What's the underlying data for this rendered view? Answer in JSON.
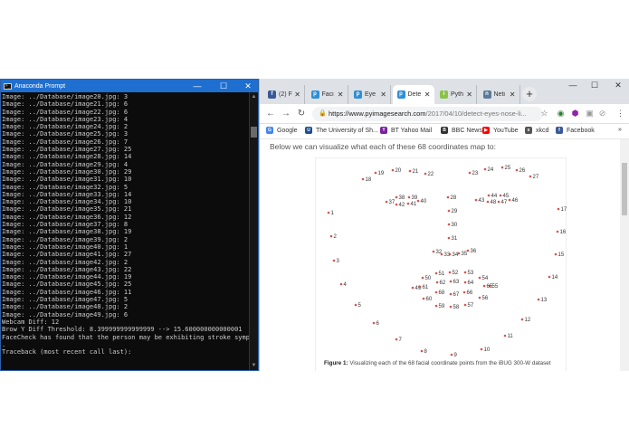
{
  "prompt": {
    "title": "Anaconda Prompt",
    "lines": [
      "Image: ../Database/image20.jpg: 3",
      "Image: ../Database/image21.jpg: 6",
      "Image: ../Database/image22.jpg: 6",
      "Image: ../Database/image23.jpg: 4",
      "Image: ../Database/image24.jpg: 2",
      "Image: ../Database/image25.jpg: 3",
      "Image: ../Database/image26.jpg: 7",
      "Image: ../Database/image27.jpg: 25",
      "Image: ../Database/image28.jpg: 14",
      "Image: ../Database/image29.jpg: 4",
      "Image: ../Database/image30.jpg: 29",
      "Image: ../Database/image31.jpg: 10",
      "Image: ../Database/image32.jpg: 5",
      "Image: ../Database/image33.jpg: 14",
      "Image: ../Database/image34.jpg: 10",
      "Image: ../Database/image35.jpg: 21",
      "Image: ../Database/image36.jpg: 12",
      "Image: ../Database/image37.jpg: 8",
      "Image: ../Database/image38.jpg: 19",
      "Image: ../Database/image39.jpg: 2",
      "Image: ../Database/image40.jpg: 1",
      "Image: ../Database/image41.jpg: 27",
      "Image: ../Database/image42.jpg: 2",
      "Image: ../Database/image43.jpg: 22",
      "Image: ../Database/image44.jpg: 19",
      "Image: ../Database/image45.jpg: 25",
      "Image: ../Database/image46.jpg: 11",
      "Image: ../Database/image47.jpg: 5",
      "Image: ../Database/image48.jpg: 2",
      "Image: ../Database/image49.jpg: 6",
      "Webcam Diff: 12",
      "Brow Y Diff Threshold: 8.399999999999999 --> 15.600000000000001",
      "FaceCheck has found that the person may be exhibiting stroke symptoms",
      ".",
      "Traceback (most recent call last):"
    ]
  },
  "browser": {
    "tabs": [
      {
        "label": "(2) F",
        "favicon": "f",
        "color": "#3b5998"
      },
      {
        "label": "Faci",
        "favicon": "p",
        "color": "#2d8fd5"
      },
      {
        "label": "Eye",
        "favicon": "p",
        "color": "#2d8fd5"
      },
      {
        "label": "Dete",
        "favicon": "p",
        "color": "#2d8fd5"
      },
      {
        "label": "Pyth",
        "favicon": "ipy",
        "color": "#8bc34a"
      },
      {
        "label": "Neti",
        "favicon": "n",
        "color": "#5b7a99"
      }
    ],
    "active_tab": 3,
    "url_domain": "https://www.pyimagesearch.com",
    "url_path": "/2017/04/10/detect-eyes-nose-li...",
    "bookmarks": [
      {
        "label": "Google",
        "icon": "G",
        "color": "#4285f4"
      },
      {
        "label": "The University of Sh...",
        "icon": "U",
        "color": "#1d4f91"
      },
      {
        "label": "BT Yahoo Mail",
        "icon": "Y",
        "color": "#7b1fa2"
      },
      {
        "label": "BBC News",
        "icon": "BBC",
        "color": "#333333"
      },
      {
        "label": "YouTube",
        "icon": "▶",
        "color": "#ff0000"
      },
      {
        "label": "xkcd",
        "icon": "x",
        "color": "#555555"
      },
      {
        "label": "Facebook",
        "icon": "f",
        "color": "#3b5998"
      }
    ],
    "bookmarks_more": "»"
  },
  "article": {
    "intro": "Below we can visualize what each of these 68 coordinates map to:",
    "caption_label": "Figure 1:",
    "caption_text": "Visualizing each of the 68 facial coordinate points from the iBUG 300-W dataset"
  },
  "landmarks": [
    [
      1,
      14,
      60
    ],
    [
      2,
      17,
      86
    ],
    [
      3,
      20,
      113
    ],
    [
      4,
      28,
      139
    ],
    [
      5,
      44,
      162
    ],
    [
      6,
      64,
      182
    ],
    [
      7,
      89,
      200
    ],
    [
      8,
      117,
      213
    ],
    [
      9,
      150,
      217
    ],
    [
      10,
      183,
      211
    ],
    [
      11,
      209,
      196
    ],
    [
      12,
      228,
      178
    ],
    [
      13,
      246,
      156
    ],
    [
      14,
      258,
      131
    ],
    [
      15,
      265,
      106
    ],
    [
      16,
      267,
      81
    ],
    [
      17,
      268,
      56
    ],
    [
      18,
      52,
      23
    ],
    [
      19,
      66,
      16
    ],
    [
      20,
      85,
      13
    ],
    [
      21,
      104,
      14
    ],
    [
      22,
      121,
      17
    ],
    [
      23,
      170,
      16
    ],
    [
      24,
      187,
      12
    ],
    [
      25,
      206,
      10
    ],
    [
      26,
      222,
      13
    ],
    [
      27,
      237,
      20
    ],
    [
      28,
      146,
      43
    ],
    [
      29,
      147,
      58
    ],
    [
      30,
      147,
      73
    ],
    [
      31,
      147,
      88
    ],
    [
      32,
      130,
      103
    ],
    [
      33,
      139,
      106
    ],
    [
      34,
      148,
      106
    ],
    [
      35,
      158,
      105
    ],
    [
      36,
      168,
      102
    ],
    [
      37,
      78,
      48
    ],
    [
      38,
      89,
      43
    ],
    [
      39,
      103,
      43
    ],
    [
      40,
      113,
      47
    ],
    [
      41,
      102,
      50
    ],
    [
      42,
      89,
      51
    ],
    [
      43,
      177,
      46
    ],
    [
      44,
      191,
      41
    ],
    [
      45,
      204,
      41
    ],
    [
      46,
      214,
      46
    ],
    [
      47,
      202,
      48
    ],
    [
      48,
      190,
      48
    ],
    [
      49,
      107,
      143
    ],
    [
      50,
      118,
      132
    ],
    [
      51,
      133,
      127
    ],
    [
      52,
      148,
      126
    ],
    [
      53,
      165,
      126
    ],
    [
      54,
      181,
      132
    ],
    [
      55,
      192,
      141
    ],
    [
      56,
      181,
      154
    ],
    [
      57,
      165,
      162
    ],
    [
      58,
      149,
      164
    ],
    [
      59,
      133,
      163
    ],
    [
      60,
      119,
      155
    ],
    [
      61,
      115,
      142
    ],
    [
      62,
      134,
      137
    ],
    [
      63,
      149,
      136
    ],
    [
      64,
      165,
      137
    ],
    [
      65,
      186,
      141
    ],
    [
      66,
      164,
      148
    ],
    [
      67,
      149,
      150
    ],
    [
      68,
      133,
      148
    ]
  ],
  "colors": {
    "titlebar": "#1f6fd1",
    "landmark_point": "#d9534f",
    "landmark_label": "#333333"
  }
}
